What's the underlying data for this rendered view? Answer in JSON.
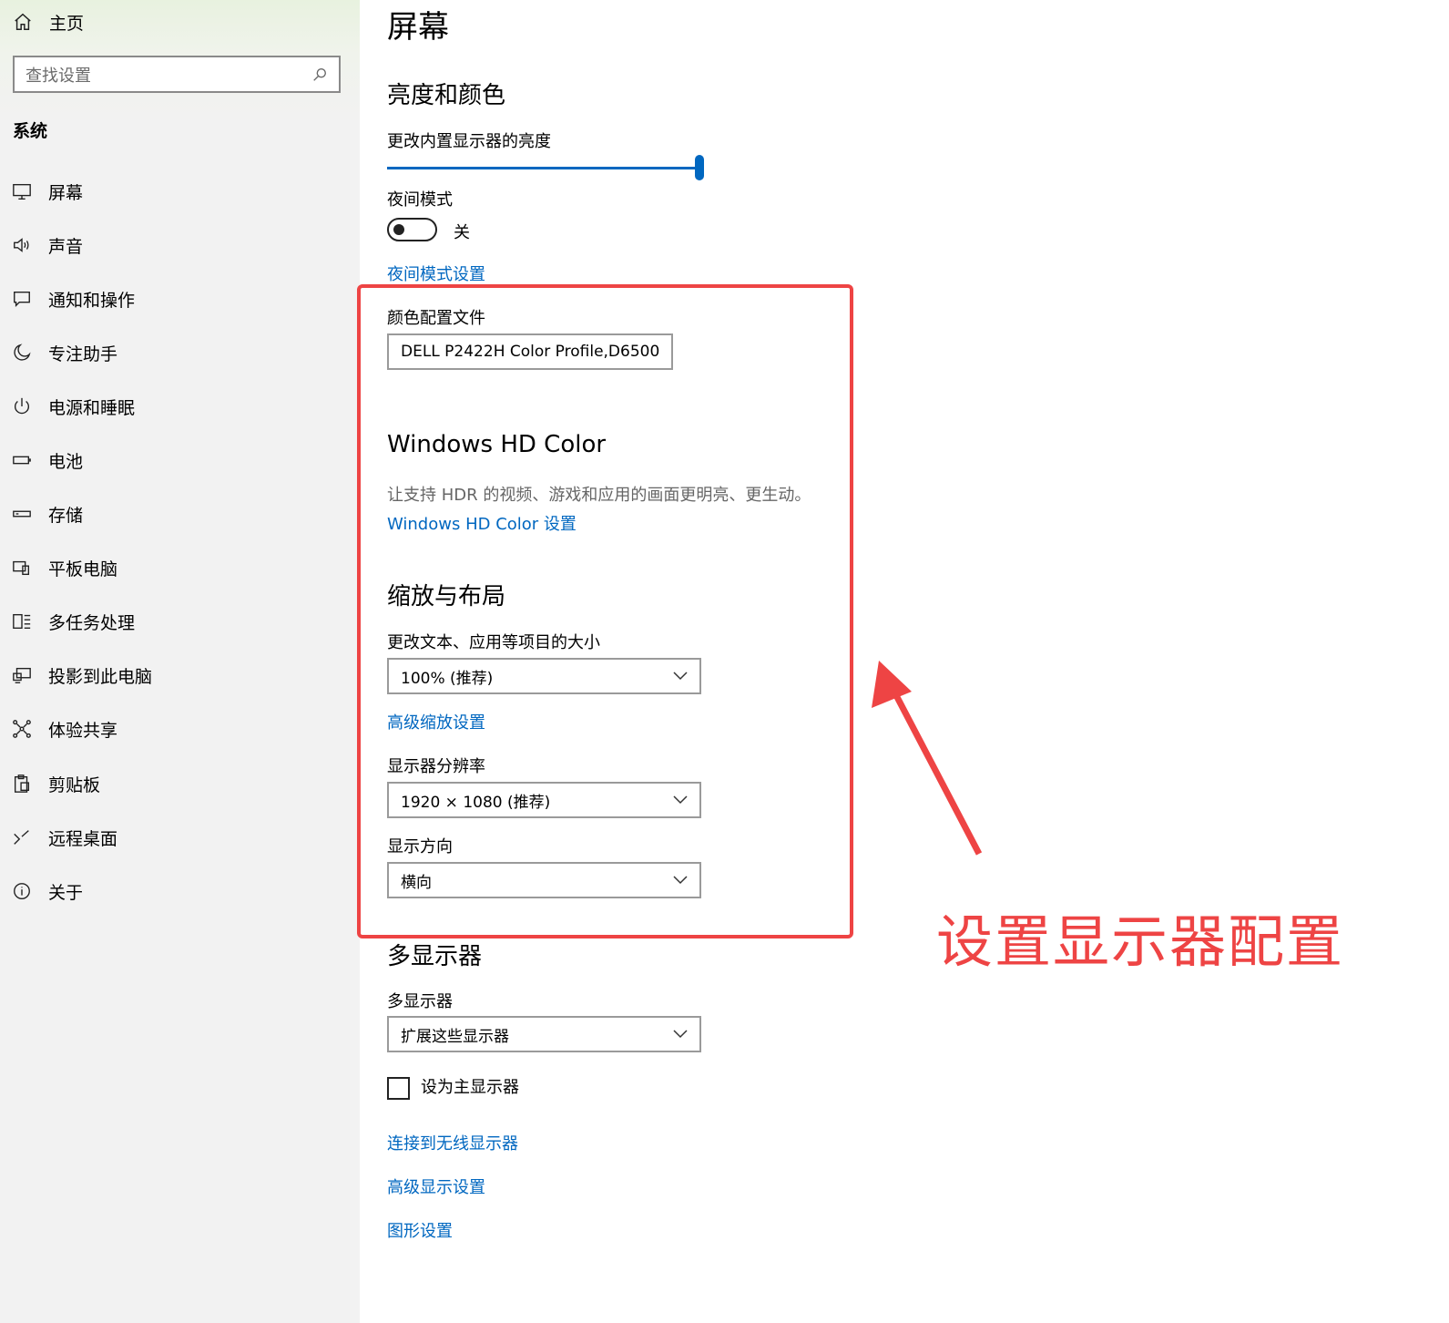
{
  "sidebar": {
    "home_label": "主页",
    "search_placeholder": "查找设置",
    "section_label": "系统",
    "items": [
      {
        "label": "屏幕",
        "icon": "monitor-icon"
      },
      {
        "label": "声音",
        "icon": "speaker-icon"
      },
      {
        "label": "通知和操作",
        "icon": "message-icon"
      },
      {
        "label": "专注助手",
        "icon": "moon-icon"
      },
      {
        "label": "电源和睡眠",
        "icon": "power-icon"
      },
      {
        "label": "电池",
        "icon": "battery-icon"
      },
      {
        "label": "存储",
        "icon": "storage-icon"
      },
      {
        "label": "平板电脑",
        "icon": "tablet-icon"
      },
      {
        "label": "多任务处理",
        "icon": "multitask-icon"
      },
      {
        "label": "投影到此电脑",
        "icon": "project-icon"
      },
      {
        "label": "体验共享",
        "icon": "share-icon"
      },
      {
        "label": "剪贴板",
        "icon": "clipboard-icon"
      },
      {
        "label": "远程桌面",
        "icon": "remote-icon"
      },
      {
        "label": "关于",
        "icon": "info-icon"
      }
    ]
  },
  "main": {
    "page_title": "屏幕",
    "brightness": {
      "heading": "亮度和颜色",
      "label": "更改内置显示器的亮度",
      "value_percent": 100
    },
    "night_mode": {
      "label": "夜间模式",
      "state": "关",
      "settings_link": "夜间模式设置"
    },
    "color_profile": {
      "label": "颜色配置文件",
      "value": "DELL P2422H  Color Profile,D6500"
    },
    "hd_color": {
      "heading": "Windows HD Color",
      "description": "让支持 HDR 的视频、游戏和应用的画面更明亮、更生动。",
      "link": "Windows HD Color 设置"
    },
    "scale_layout": {
      "heading": "缩放与布局",
      "scale_label": "更改文本、应用等项目的大小",
      "scale_value": "100% (推荐)",
      "advanced_scale_link": "高级缩放设置",
      "resolution_label": "显示器分辨率",
      "resolution_value": "1920 × 1080 (推荐)",
      "orientation_label": "显示方向",
      "orientation_value": "横向"
    },
    "multi_display": {
      "heading": "多显示器",
      "label": "多显示器",
      "value": "扩展这些显示器",
      "primary_checkbox_label": "设为主显示器",
      "wireless_link": "连接到无线显示器",
      "advanced_link": "高级显示设置",
      "graphics_link": "图形设置"
    }
  },
  "annotation": {
    "text": "设置显示器配置",
    "color": "#ee4444"
  },
  "colors": {
    "accent": "#0067c0",
    "sidebar_bg": "#f2f2f2"
  }
}
